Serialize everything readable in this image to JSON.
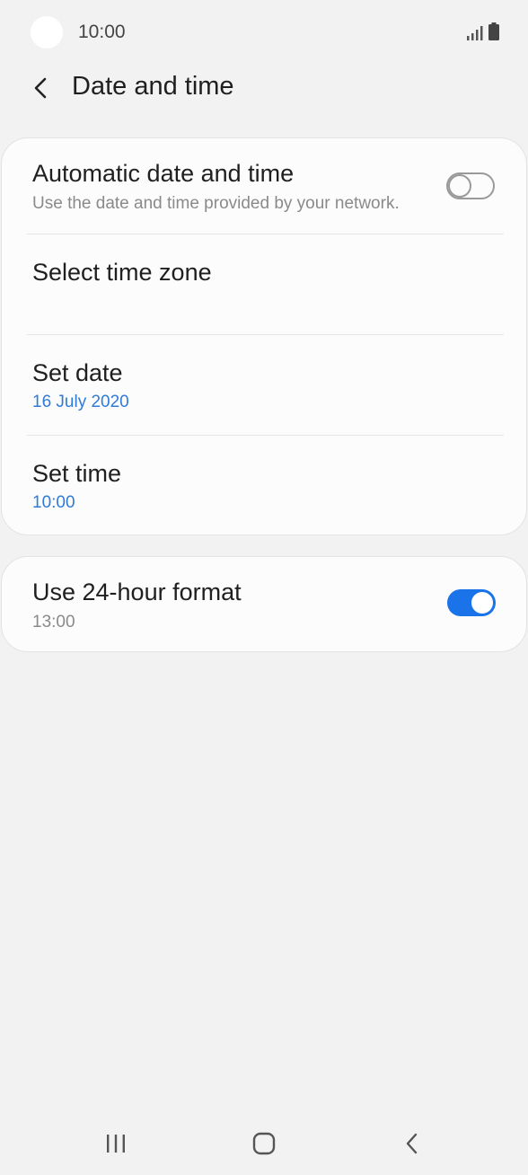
{
  "status_bar": {
    "time": "10:00",
    "icons": [
      "signal-icon",
      "battery-icon"
    ]
  },
  "header": {
    "back_icon": "chevron-left-icon",
    "title": "Date and time"
  },
  "settings": {
    "automatic": {
      "title": "Automatic date and time",
      "subtitle": "Use the date and time provided by your network.",
      "enabled": false
    },
    "time_zone": {
      "title": "Select time zone"
    },
    "set_date": {
      "title": "Set date",
      "value": "16 July 2020"
    },
    "set_time": {
      "title": "Set time",
      "value": "10:00"
    },
    "format_24h": {
      "title": "Use 24-hour format",
      "value": "13:00",
      "enabled": true
    }
  },
  "nav_bar": {
    "icons": [
      "recent-apps-icon",
      "home-icon",
      "back-icon"
    ]
  },
  "colors": {
    "accent": "#1a73e8",
    "value_blue": "#2f7bd8",
    "background": "#f2f2f2"
  }
}
